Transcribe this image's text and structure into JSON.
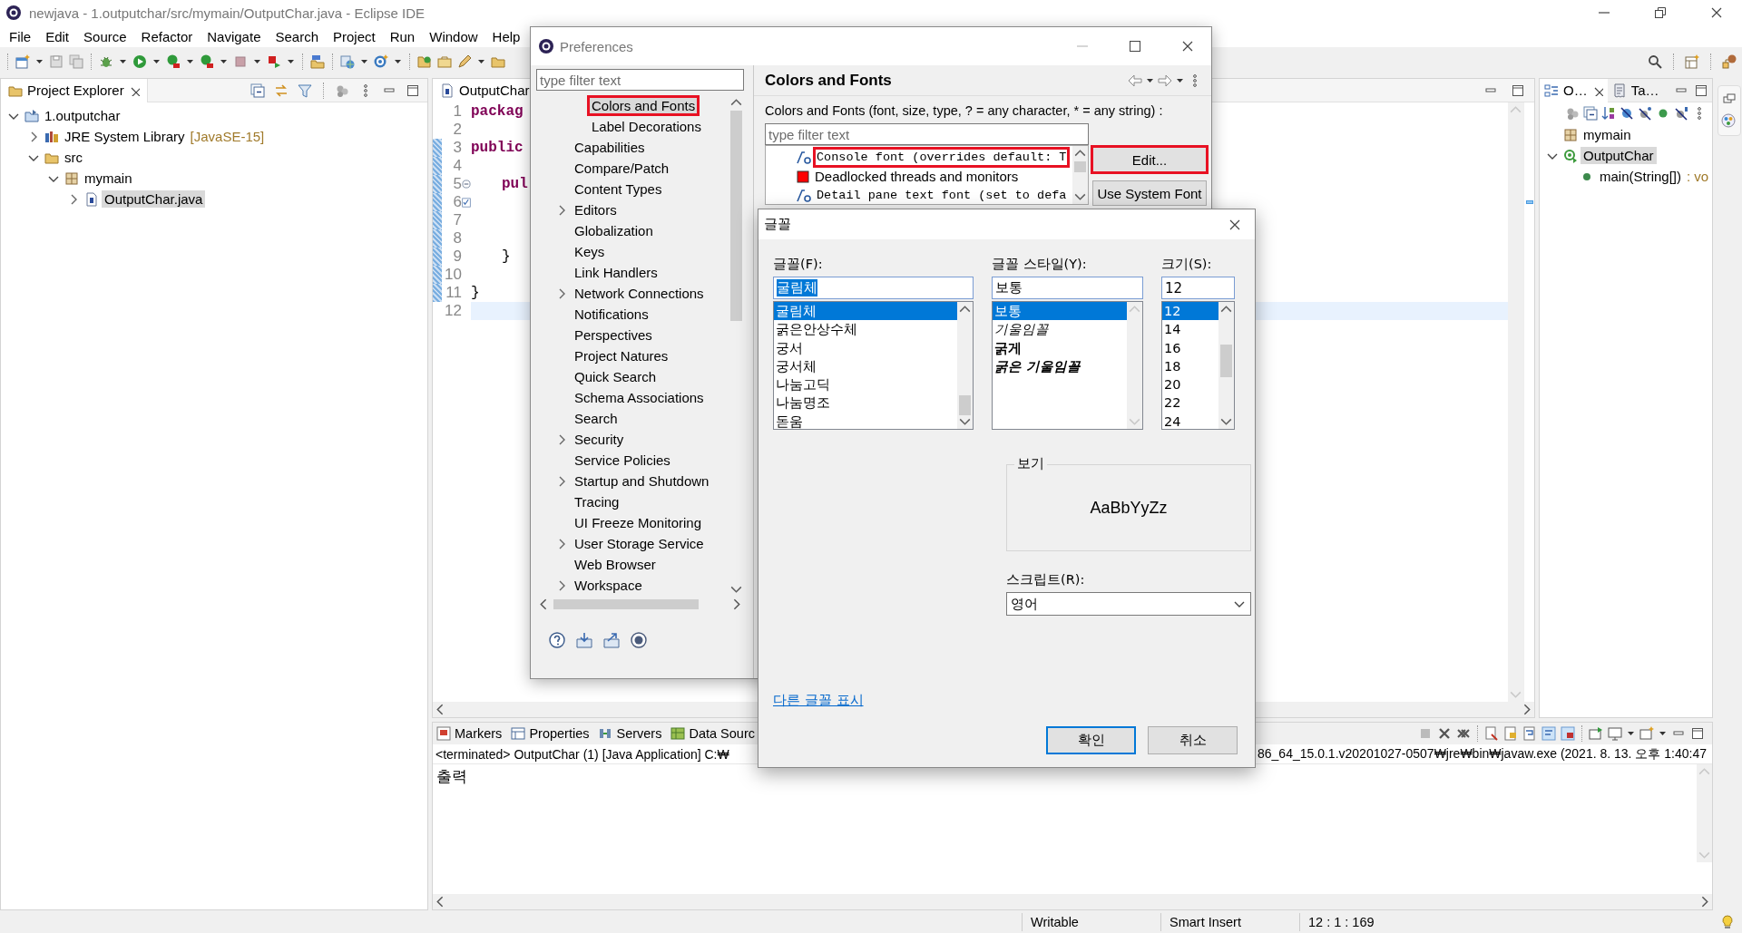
{
  "window": {
    "title": "newjava - 1.outputchar/src/mymain/OutputChar.java - Eclipse IDE"
  },
  "menu": [
    "File",
    "Edit",
    "Source",
    "Refactor",
    "Navigate",
    "Search",
    "Project",
    "Run",
    "Window",
    "Help"
  ],
  "project_explorer": {
    "title": "Project Explorer",
    "tree": [
      {
        "label": "1.outputchar",
        "kind": "project",
        "expanded": true,
        "selected": false,
        "children": [
          {
            "label": "JRE System Library",
            "decoration": "[JavaSE-15]",
            "kind": "library",
            "expanded": false,
            "selected": false
          },
          {
            "label": "src",
            "kind": "source-folder",
            "expanded": true,
            "selected": false,
            "children": [
              {
                "label": "mymain",
                "kind": "package",
                "expanded": true,
                "selected": false,
                "children": [
                  {
                    "label": "OutputChar.java",
                    "kind": "java-file",
                    "expanded": false,
                    "selected": true
                  }
                ]
              }
            ]
          }
        ]
      }
    ]
  },
  "editor": {
    "tab": "OutputChar.",
    "lines": [
      {
        "number": "1",
        "code": "packag",
        "kind": "keyword",
        "current": false,
        "range": false
      },
      {
        "number": "2",
        "current": false,
        "range": false
      },
      {
        "number": "3",
        "code": "public",
        "kind": "keyword",
        "current": false,
        "range": true
      },
      {
        "number": "4",
        "current": false,
        "range": true
      },
      {
        "number": "5",
        "code": "pul",
        "indent": true,
        "kind": "keyword",
        "current": false,
        "range": true,
        "gutter": {
          "kind": "fold"
        }
      },
      {
        "number": "6",
        "current": false,
        "range": true,
        "gutter": {
          "kind": "task"
        }
      },
      {
        "number": "7",
        "current": false,
        "range": true
      },
      {
        "number": "8",
        "current": false,
        "range": true
      },
      {
        "number": "9",
        "code": "}",
        "indent": true,
        "kind": "plain",
        "current": false,
        "range": true
      },
      {
        "number": "10",
        "current": false,
        "range": true
      },
      {
        "number": "11",
        "code": "}",
        "kind": "plain",
        "current": false,
        "range": true
      },
      {
        "number": "12",
        "current": true,
        "range": false
      }
    ]
  },
  "outline": {
    "tabs": [
      {
        "label": "O…",
        "selected": true
      },
      {
        "label": "Ta…",
        "selected": false
      }
    ],
    "tree": [
      {
        "label": "mymain",
        "kind": "package",
        "selected": false
      },
      {
        "label": "OutputChar",
        "kind": "class",
        "expanded": true,
        "selected": true,
        "children": [
          {
            "label": "main(String[])",
            "type": ": vo",
            "kind": "method",
            "selected": false
          }
        ]
      }
    ]
  },
  "bottom_panel": {
    "tabs": [
      {
        "label": "Markers"
      },
      {
        "label": "Properties"
      },
      {
        "label": "Servers"
      },
      {
        "label": "Data Sourc"
      }
    ],
    "console_header": [
      "<terminated> OutputChar (1) [Java Application] C:₩",
      "86_64_15.0.1.v20201027-0507₩jre₩bin₩javaw.exe  (2021. 8. 13. 오후 1:40:47"
    ],
    "output": "출력"
  },
  "status_bar": [
    "Writable",
    "Smart Insert",
    "12 : 1 : 169"
  ],
  "preferences": {
    "title": "Preferences",
    "filter": {
      "placeholder": "type filter text"
    },
    "tree": [
      {
        "children": [
          {
            "label": "Colors and Fonts",
            "selected": true,
            "highlighted": true
          },
          {
            "label": "Label Decorations",
            "selected": false,
            "highlighted": false
          }
        ]
      },
      {
        "label": "Capabilities",
        "selected": false
      },
      {
        "label": "Compare/Patch",
        "selected": false
      },
      {
        "label": "Content Types",
        "selected": false
      },
      {
        "label": "Editors",
        "expanded": false,
        "selected": false
      },
      {
        "label": "Globalization",
        "selected": false
      },
      {
        "label": "Keys",
        "selected": false
      },
      {
        "label": "Link Handlers",
        "selected": false
      },
      {
        "label": "Network Connections",
        "expanded": false,
        "selected": false
      },
      {
        "label": "Notifications",
        "selected": false
      },
      {
        "label": "Perspectives",
        "selected": false
      },
      {
        "label": "Project Natures",
        "selected": false
      },
      {
        "label": "Quick Search",
        "selected": false
      },
      {
        "label": "Schema Associations",
        "selected": false
      },
      {
        "label": "Search",
        "selected": false
      },
      {
        "label": "Security",
        "expanded": false,
        "selected": false
      },
      {
        "label": "Service Policies",
        "selected": false
      },
      {
        "label": "Startup and Shutdown",
        "expanded": false,
        "selected": false
      },
      {
        "label": "Tracing",
        "selected": false
      },
      {
        "label": "UI Freeze Monitoring",
        "selected": false
      },
      {
        "label": "User Storage Service",
        "expanded": false,
        "selected": false
      },
      {
        "label": "Web Browser",
        "selected": false
      },
      {
        "label": "Workspace",
        "expanded": false,
        "selected": false
      }
    ],
    "page": {
      "title": "Colors and Fonts",
      "description": "Colors and Fonts (font, size, type, ? = any character, * = any string) :",
      "filter": {
        "placeholder": "type filter text"
      },
      "entries": [
        {
          "label": "Console font (overrides default: T",
          "kind": "font",
          "highlighted": true
        },
        {
          "label": "Deadlocked threads and monitors",
          "kind": "color",
          "color": "#ff0000"
        },
        {
          "label": "Detail pane text font (set to defa",
          "kind": "font"
        }
      ],
      "buttons": [
        {
          "label": "Edit...",
          "highlighted": true
        },
        {
          "label": "Use System Font"
        }
      ]
    }
  },
  "font_dialog": {
    "title": "글꼴",
    "font": {
      "label": "글꼴(F):",
      "value": "굴림체",
      "value_selected": true,
      "options": [
        {
          "label": "굴림체",
          "selected": true
        },
        {
          "label": "굵은안상수체",
          "selected": false
        },
        {
          "label": "궁서",
          "selected": false
        },
        {
          "label": "궁서체",
          "selected": false
        },
        {
          "label": "나눔고딕",
          "selected": false
        },
        {
          "label": "나눔명조",
          "selected": false
        },
        {
          "label": "돋움",
          "selected": false
        }
      ]
    },
    "style": {
      "label": "글꼴 스타일(Y):",
      "value": "보통",
      "options": [
        {
          "label": "보통",
          "kind": "regular",
          "selected": true
        },
        {
          "label": "기울임꼴",
          "kind": "italic",
          "selected": false
        },
        {
          "label": "굵게",
          "kind": "bold",
          "selected": false
        },
        {
          "label": "굵은 기울임꼴",
          "kind": "bold-italic",
          "selected": false
        }
      ]
    },
    "size": {
      "label": "크기(S):",
      "value": "12",
      "options": [
        {
          "label": "12",
          "selected": true
        },
        {
          "label": "14",
          "selected": false
        },
        {
          "label": "16",
          "selected": false
        },
        {
          "label": "18",
          "selected": false
        },
        {
          "label": "20",
          "selected": false
        },
        {
          "label": "22",
          "selected": false
        },
        {
          "label": "24",
          "selected": false
        }
      ]
    },
    "preview": {
      "label": "보기",
      "sample": "AaBbYyZz"
    },
    "script": {
      "label": "스크립트(R):",
      "value": "영어"
    },
    "link": "다른 글꼴 표시",
    "buttons": [
      {
        "label": "확인",
        "default": true
      },
      {
        "label": "취소",
        "default": false
      }
    ]
  }
}
